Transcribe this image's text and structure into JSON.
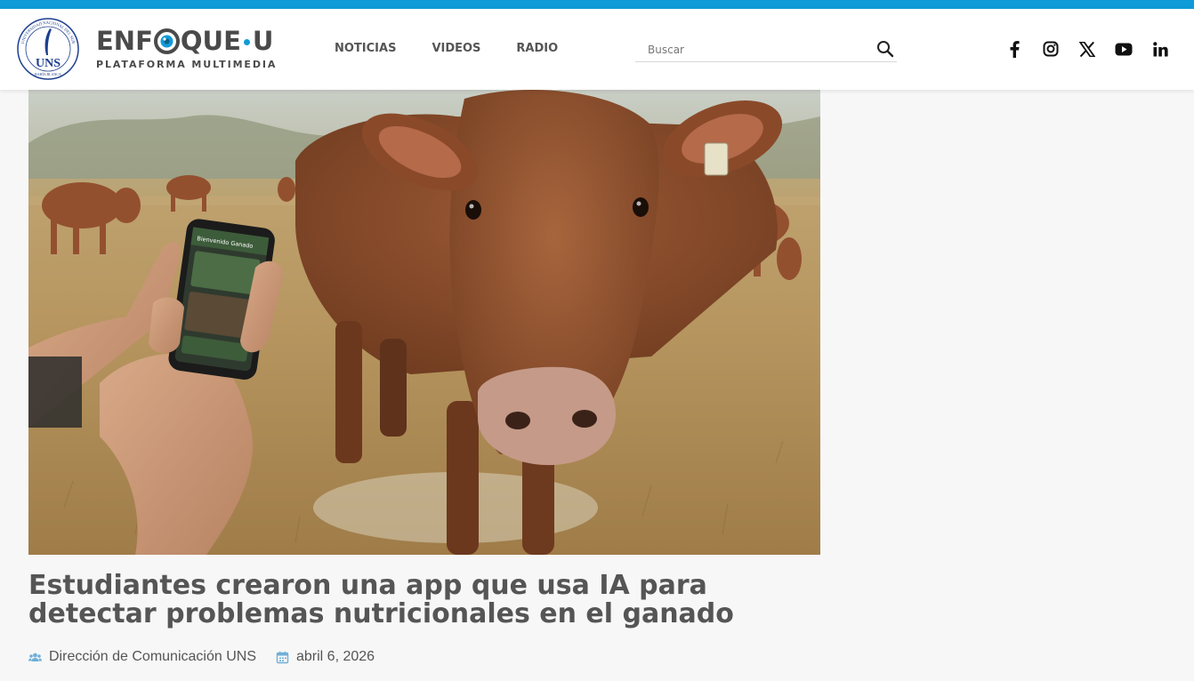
{
  "brand": {
    "name_left": "ENF",
    "name_right": "QUE",
    "name_end": "U",
    "tagline": "PLATAFORMA MULTIMEDIA",
    "accent": "#0f9bd7"
  },
  "seal": {
    "initials": "UNS",
    "ring_text": "UNIVERSIDAD NACIONAL DEL SUR",
    "city": "BAHÍA BLANCA"
  },
  "nav": {
    "items": [
      "NOTICIAS",
      "VIDEOS",
      "RADIO"
    ]
  },
  "search": {
    "placeholder": "Buscar",
    "value": ""
  },
  "social": {
    "icons": [
      "facebook-icon",
      "instagram-icon",
      "x-icon",
      "youtube-icon",
      "linkedin-icon"
    ]
  },
  "article": {
    "hero_image": "cow-with-phone-app",
    "title": "Estudiantes crearon una app que usa IA para detectar problemas nutricionales en el ganado",
    "author": "Dirección de Comunicación UNS",
    "date": "abril 6, 2026"
  },
  "phone_screen": {
    "header": "Bienvenido Ganado"
  }
}
